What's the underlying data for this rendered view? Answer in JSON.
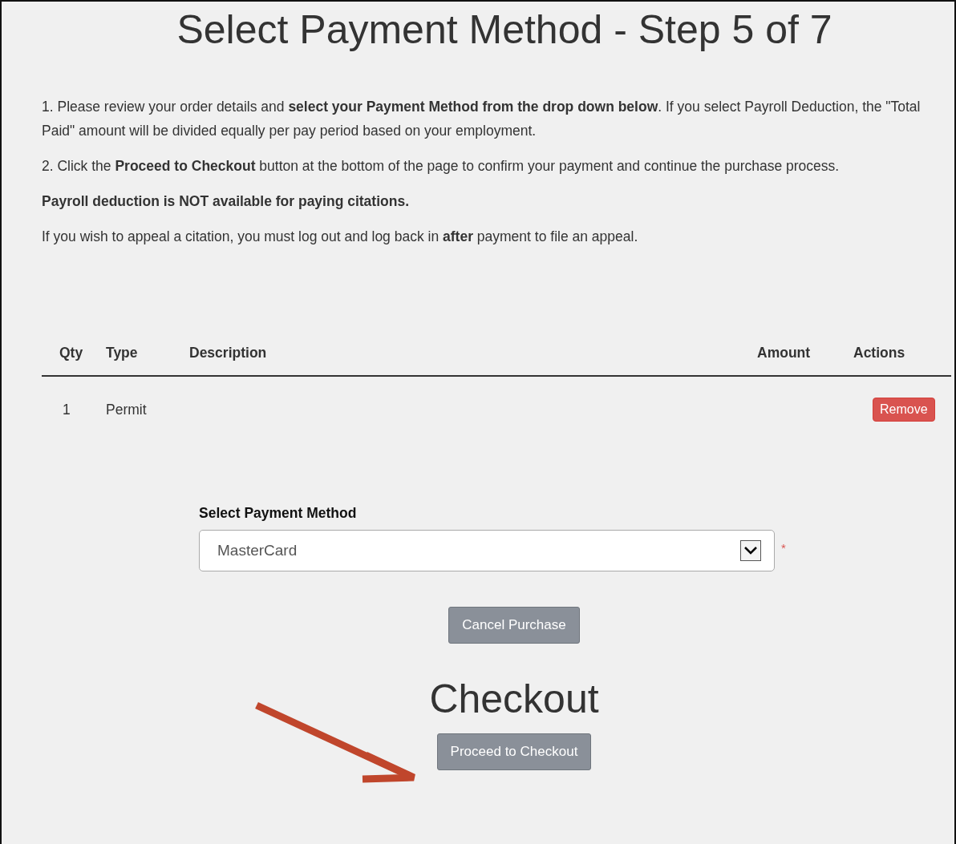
{
  "title": "Select Payment Method - Step 5 of 7",
  "instructions": [
    "1. Please review your order details and **select your Payment Method from the drop down below**. If you select Payroll Deduction, the \"Total Paid\" amount will be divided equally per pay period based on your employment.",
    "2. Click the **Proceed to Checkout** button at the bottom of the page to confirm your payment and continue the purchase process.",
    "**Payroll deduction is NOT available for paying citations.**",
    "If you wish to appeal a citation, you must log out and log back in **after** payment to file an appeal."
  ],
  "table": {
    "columns": [
      "Qty",
      "Type",
      "Description",
      "Amount",
      "Actions"
    ],
    "rows": [
      {
        "qty": "1",
        "type": "Permit",
        "action": "Remove"
      }
    ]
  },
  "payment": {
    "label": "Select Payment Method",
    "value": "MasterCard",
    "required_mark": "*"
  },
  "cancel_button": "Cancel Purchase",
  "checkout_heading": "Checkout",
  "proceed_button": "Proceed to Checkout"
}
